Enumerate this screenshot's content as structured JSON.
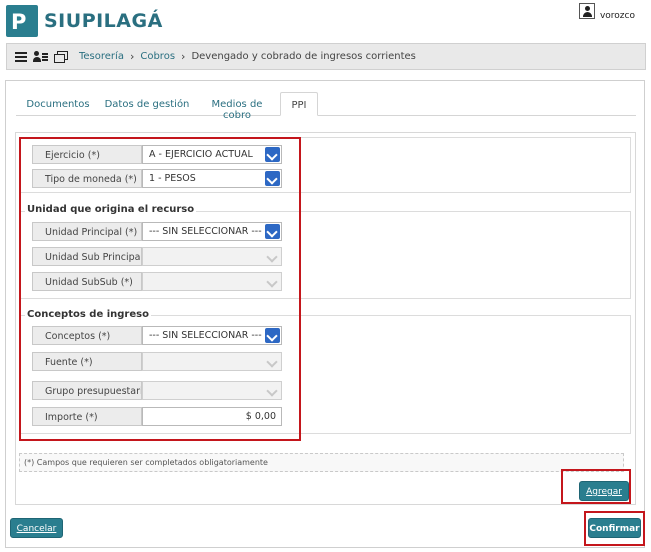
{
  "brand": {
    "name_prefix": "SIU",
    "name_suffix": "PILAGÁ",
    "logo_letter": "P"
  },
  "user": {
    "name": "vorozco",
    "icon": "user-icon"
  },
  "breadcrumb": {
    "icons": [
      "menu-icon",
      "users-icon",
      "windows-icon"
    ],
    "items": [
      "Tesorería",
      "Cobros",
      "Devengado y cobrado de ingresos corrientes"
    ],
    "separator": "›"
  },
  "tabs": [
    {
      "label": "Documentos",
      "active": false
    },
    {
      "label": "Datos de gestión",
      "active": false
    },
    {
      "label": "Medios de cobro",
      "active": false
    },
    {
      "label": "PPI",
      "active": true
    }
  ],
  "form": {
    "ejercicio": {
      "label": "Ejercicio (*)",
      "value": "A - EJERCICIO ACTUAL"
    },
    "moneda": {
      "label": "Tipo de moneda (*)",
      "value": "1 - PESOS"
    },
    "unidad": {
      "legend": "Unidad que origina el recurso",
      "principal": {
        "label": "Unidad Principal (*)",
        "value": "--- SIN SELECCIONAR ---"
      },
      "sub_principal": {
        "label": "Unidad Sub Principal (*)",
        "value": ""
      },
      "subsub": {
        "label": "Unidad SubSub (*)",
        "value": ""
      }
    },
    "conceptos": {
      "legend": "Conceptos de ingreso",
      "conceptos": {
        "label": "Conceptos (*)",
        "value": "--- SIN SELECCIONAR ---"
      },
      "fuente": {
        "label": "Fuente (*)",
        "value": ""
      },
      "grupo": {
        "label": "Grupo presupuestario (*)",
        "value": ""
      },
      "importe": {
        "label": "Importe (*)",
        "value": "$ 0,00"
      }
    },
    "note": "(*) Campos que requieren ser completados obligatoriamente"
  },
  "buttons": {
    "agregar": "Agregar",
    "cancelar": "Cancelar",
    "confirmar": "Confirmar"
  },
  "colors": {
    "brand": "#2a7e8f",
    "highlight": "#c4161c",
    "select_caret": "#2d68c4"
  }
}
